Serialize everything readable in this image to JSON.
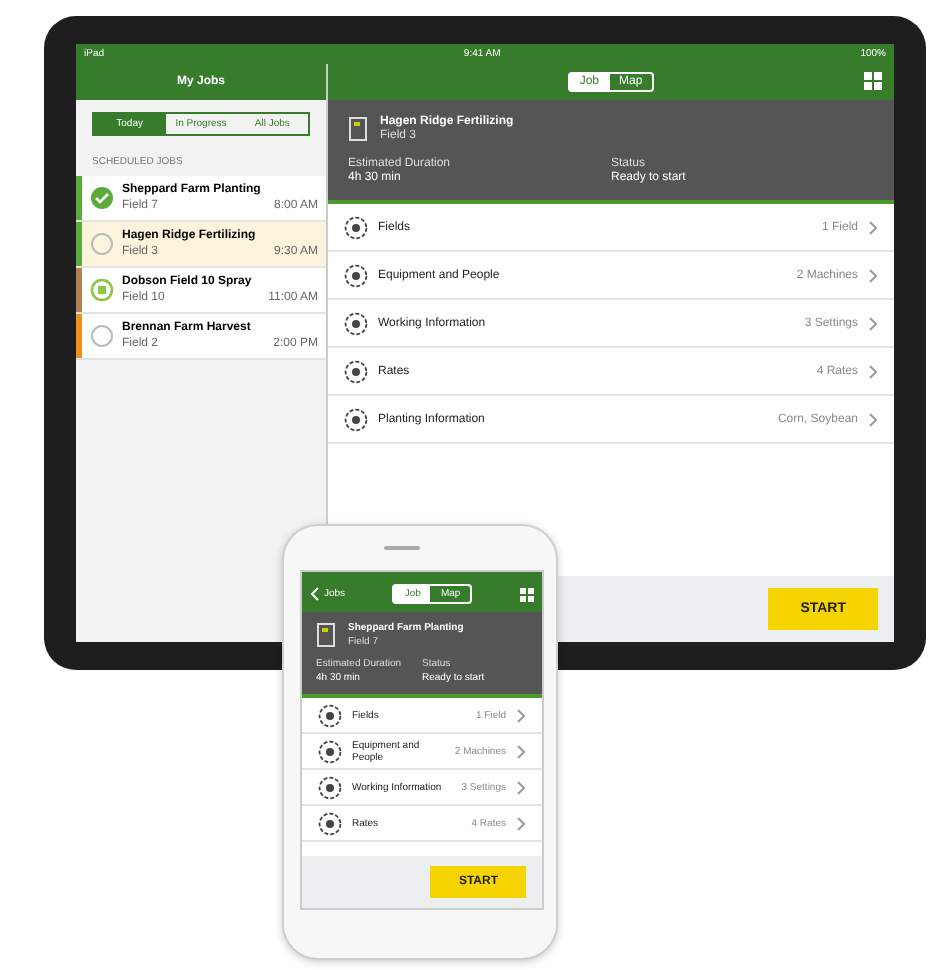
{
  "tablet": {
    "status_bar": {
      "carrier": "iPad",
      "time": "9:41 AM",
      "battery": "100%"
    },
    "left_title": "My Jobs",
    "filter_tabs": [
      {
        "label": "Today",
        "selected": true
      },
      {
        "label": "In Progress",
        "selected": false
      },
      {
        "label": "All Jobs",
        "selected": false
      }
    ],
    "section_title": "SCHEDULED JOBS",
    "jobs": [
      {
        "name": "Sheppard Farm Planting",
        "field": "Field 7",
        "time": "8:00 AM",
        "color": "#5aab3c",
        "kind": "done",
        "selected": false
      },
      {
        "name": "Hagen Ridge Fertilizing",
        "field": "Field 3",
        "time": "9:30 AM",
        "color": "#5aab3c",
        "kind": "pending",
        "selected": true
      },
      {
        "name": "Dobson Field 10 Spray",
        "field": "Field 10",
        "time": "11:00 AM",
        "color": "#b08050",
        "kind": "active",
        "selected": false
      },
      {
        "name": "Brennan Farm Harvest",
        "field": "Field 2",
        "time": "2:00 PM",
        "color": "#f0901e",
        "kind": "pending",
        "selected": false
      }
    ],
    "view_toggle": [
      {
        "label": "Job",
        "selected": true
      },
      {
        "label": "Map",
        "selected": false
      }
    ],
    "job_header": {
      "title": "Hagen Ridge Fertilizing",
      "subtitle": "Field 3",
      "duration_label": "Estimated Duration",
      "duration": "4h 30 min",
      "status_label": "Status",
      "status": "Ready to start"
    },
    "details": [
      {
        "label": "Fields",
        "value": "1 Field"
      },
      {
        "label": "Equipment and People",
        "value": "2 Machines"
      },
      {
        "label": "Working Information",
        "value": "3 Settings"
      },
      {
        "label": "Rates",
        "value": "4 Rates"
      },
      {
        "label": "Planting Information",
        "value": "Corn, Soybean"
      }
    ],
    "action": "START"
  },
  "phone": {
    "back": "Jobs",
    "view_toggle": [
      {
        "label": "Job",
        "selected": true
      },
      {
        "label": "Map",
        "selected": false
      }
    ],
    "job_header": {
      "title": "Sheppard Farm Planting",
      "subtitle": "Field 7",
      "duration_label": "Estimated Duration",
      "duration": "4h 30 min",
      "status_label": "Status",
      "status": "Ready to start"
    },
    "details": [
      {
        "label": "Fields",
        "value": "1 Field"
      },
      {
        "label": "Equipment and People",
        "value": "2 Machines"
      },
      {
        "label": "Working Information",
        "value": "3 Settings"
      },
      {
        "label": "Rates",
        "value": "4 Rates"
      }
    ],
    "action": "START"
  }
}
